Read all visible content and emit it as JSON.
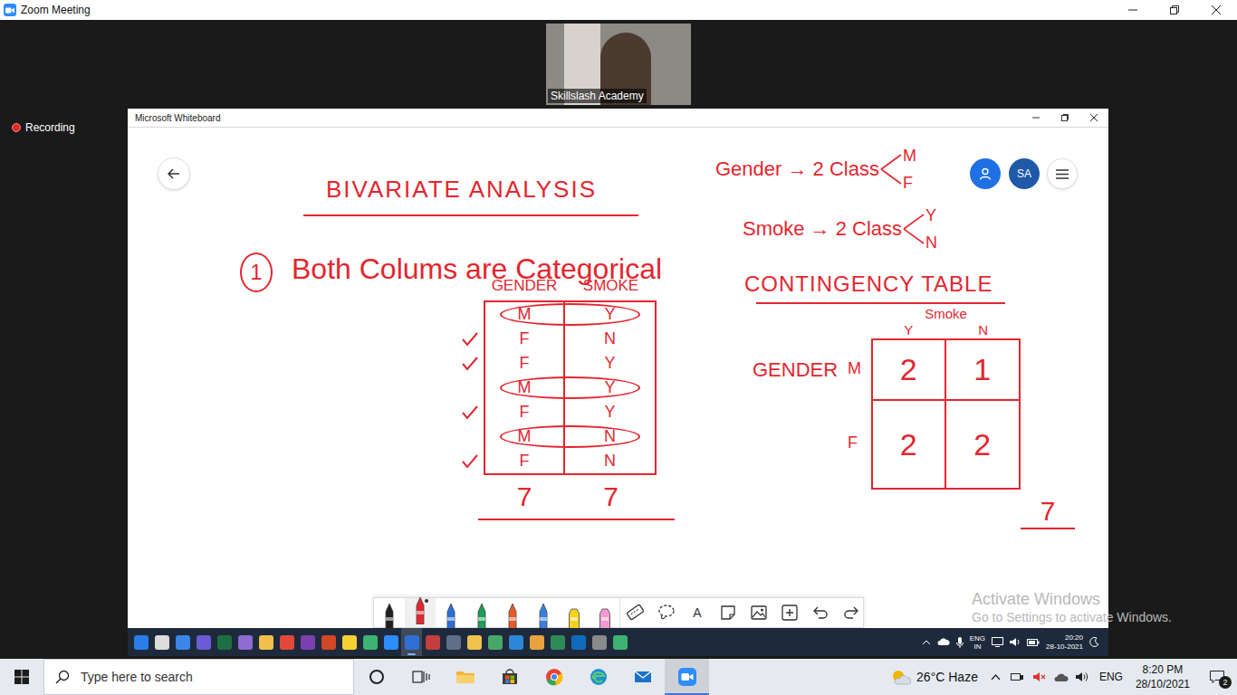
{
  "zoom": {
    "title": "Zoom Meeting",
    "recording": "Recording",
    "participant": "Skillslash Academy"
  },
  "whiteboard": {
    "title": "Microsoft Whiteboard",
    "avatar": "SA",
    "heading": "BIVARIATE ANALYSIS",
    "point_number": "1",
    "point": "Both Colums are Categorical",
    "data_table": {
      "columns": [
        "GENDER",
        "SMOKE"
      ],
      "rows": [
        {
          "cells": [
            "M",
            "Y"
          ],
          "circled": true,
          "ticked": false
        },
        {
          "cells": [
            "F",
            "N"
          ],
          "circled": false,
          "ticked": true
        },
        {
          "cells": [
            "F",
            "Y"
          ],
          "circled": false,
          "ticked": true
        },
        {
          "cells": [
            "M",
            "Y"
          ],
          "circled": true,
          "ticked": false
        },
        {
          "cells": [
            "F",
            "Y"
          ],
          "circled": false,
          "ticked": true
        },
        {
          "cells": [
            "M",
            "N"
          ],
          "circled": true,
          "ticked": false
        },
        {
          "cells": [
            "F",
            "N"
          ],
          "circled": false,
          "ticked": true
        }
      ],
      "totals": [
        "7",
        "7"
      ]
    },
    "classes": [
      {
        "label": "Gender → 2 Class",
        "values": [
          "M",
          "F"
        ]
      },
      {
        "label": "Smoke → 2 Class",
        "values": [
          "Y",
          "N"
        ]
      }
    ],
    "contingency": {
      "title": "CONTINGENCY TABLE",
      "column_title": "Smoke",
      "columns": [
        "Y",
        "N"
      ],
      "row_title": "GENDER",
      "rows": [
        {
          "label": "M",
          "cells": [
            "2",
            "1"
          ]
        },
        {
          "label": "F",
          "cells": [
            "2",
            "2"
          ]
        }
      ],
      "total": "7"
    }
  },
  "toolbar": {
    "tools": [
      {
        "kind": "pen",
        "color": "#1f1f1f",
        "selected": false
      },
      {
        "kind": "pen",
        "color": "#e3262f",
        "selected": true
      },
      {
        "kind": "pen",
        "color": "#2b6fd6",
        "selected": false
      },
      {
        "kind": "pen",
        "color": "#1e9e5a",
        "selected": false
      },
      {
        "kind": "pen",
        "color": "#e85a2a",
        "selected": false
      },
      {
        "kind": "pen",
        "color": "#3a7ee0",
        "selected": false
      },
      {
        "kind": "highlighter",
        "color": "#f5d320",
        "selected": false
      },
      {
        "kind": "highlighter",
        "color": "#f39ad0",
        "selected": false
      },
      {
        "kind": "ruler",
        "selected": false
      },
      {
        "kind": "lasso",
        "selected": false
      },
      {
        "kind": "text",
        "label": "A",
        "selected": false
      },
      {
        "kind": "note",
        "selected": false
      },
      {
        "kind": "image",
        "selected": false
      },
      {
        "kind": "insert",
        "selected": false
      },
      {
        "kind": "undo",
        "selected": false
      },
      {
        "kind": "redo",
        "selected": false
      }
    ]
  },
  "watermark": {
    "title": "Activate Windows",
    "subtitle": "Go to Settings to activate Windows."
  },
  "remote_taskbar": {
    "apps": [
      {
        "color": "#2b7de9",
        "selected": false
      },
      {
        "color": "#dcdcdc",
        "selected": false
      },
      {
        "color": "#3a86e8",
        "selected": false
      },
      {
        "color": "#6b5bd6",
        "selected": false
      },
      {
        "color": "#1d7044",
        "selected": false
      },
      {
        "color": "#8e6bd1",
        "selected": false
      },
      {
        "color": "#f2c04a",
        "selected": false
      },
      {
        "color": "#e3493a",
        "selected": false
      },
      {
        "color": "#7b3fb0",
        "selected": false
      },
      {
        "color": "#d24726",
        "selected": false
      },
      {
        "color": "#f6d033",
        "selected": false
      },
      {
        "color": "#3cb371",
        "selected": false
      },
      {
        "color": "#2d8cff",
        "selected": false
      },
      {
        "color": "#2f6fd6",
        "selected": true
      },
      {
        "color": "#c43e3e",
        "selected": false
      },
      {
        "color": "#5f6f8a",
        "selected": false
      },
      {
        "color": "#f0c14b",
        "selected": false
      },
      {
        "color": "#48a868",
        "selected": false
      },
      {
        "color": "#2b88d8",
        "selected": false
      },
      {
        "color": "#e8a33c",
        "selected": false
      },
      {
        "color": "#2e8b57",
        "selected": false
      },
      {
        "color": "#0f6cbd",
        "selected": false
      },
      {
        "color": "#8a8a8a",
        "selected": false
      },
      {
        "color": "#3cb371",
        "selected": false
      }
    ],
    "lang": "ENG",
    "region": "IN",
    "time": "20:20",
    "date": "28-10-2021"
  },
  "taskbar": {
    "search": "Type here to search",
    "pinned": [
      {
        "kind": "folder",
        "color": "#f2b632",
        "selected": false
      },
      {
        "kind": "store",
        "color": "#3a7bd5",
        "selected": false
      },
      {
        "kind": "chrome",
        "color": "#34a853",
        "selected": false
      },
      {
        "kind": "edge",
        "color": "#1f8fd6",
        "selected": false
      },
      {
        "kind": "mail",
        "color": "#1a73c9",
        "selected": false
      },
      {
        "kind": "zoom",
        "color": "#2d8cff",
        "selected": true
      }
    ],
    "weather": "26°C Haze",
    "lang": "ENG",
    "time": "8:20 PM",
    "date": "28/10/2021",
    "notifications": "2"
  }
}
